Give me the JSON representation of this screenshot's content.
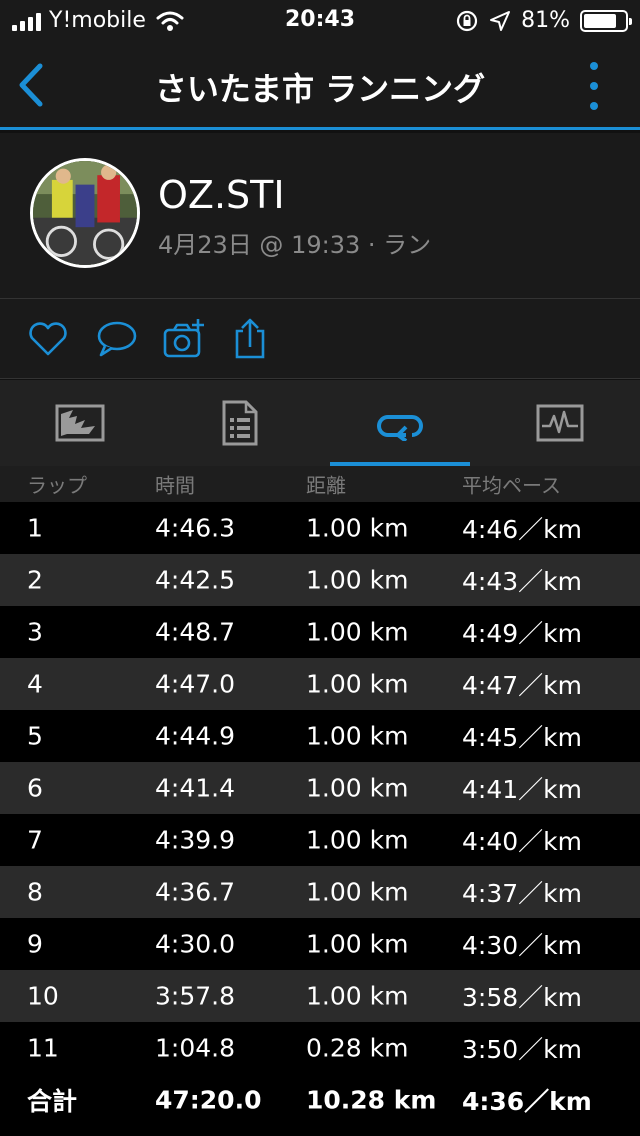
{
  "status": {
    "carrier": "Y!mobile",
    "time": "20:43",
    "battery": "81%",
    "battery_level": 0.81,
    "icons": [
      "signal-icon",
      "wifi-icon",
      "rotation-lock-icon",
      "location-arrow-icon",
      "battery-icon"
    ]
  },
  "nav": {
    "title": "さいたま市 ランニング",
    "icons": [
      "back-chevron-icon",
      "more-vertical-icon"
    ]
  },
  "activity": {
    "user": "OZ.STI",
    "meta": "4月23日 @ 19:33 · ラン"
  },
  "actions": [
    "heart-icon",
    "comment-icon",
    "add-photo-icon",
    "share-icon"
  ],
  "tabs": [
    "map-overview-icon",
    "details-icon",
    "laps-icon",
    "charts-icon"
  ],
  "active_tab": 2,
  "accent_color": "#1b8fd6",
  "laps": {
    "headers": [
      "ラップ",
      "時間",
      "距離",
      "平均ペース"
    ],
    "rows": [
      [
        "1",
        "4:46.3",
        "1.00 km",
        "4:46／km"
      ],
      [
        "2",
        "4:42.5",
        "1.00 km",
        "4:43／km"
      ],
      [
        "3",
        "4:48.7",
        "1.00 km",
        "4:49／km"
      ],
      [
        "4",
        "4:47.0",
        "1.00 km",
        "4:47／km"
      ],
      [
        "5",
        "4:44.9",
        "1.00 km",
        "4:45／km"
      ],
      [
        "6",
        "4:41.4",
        "1.00 km",
        "4:41／km"
      ],
      [
        "7",
        "4:39.9",
        "1.00 km",
        "4:40／km"
      ],
      [
        "8",
        "4:36.7",
        "1.00 km",
        "4:37／km"
      ],
      [
        "9",
        "4:30.0",
        "1.00 km",
        "4:30／km"
      ],
      [
        "10",
        "3:57.8",
        "1.00 km",
        "3:58／km"
      ],
      [
        "11",
        "1:04.8",
        "0.28 km",
        "3:50／km"
      ]
    ],
    "total": [
      "合計",
      "47:20.0",
      "10.28 km",
      "4:36／km"
    ]
  }
}
